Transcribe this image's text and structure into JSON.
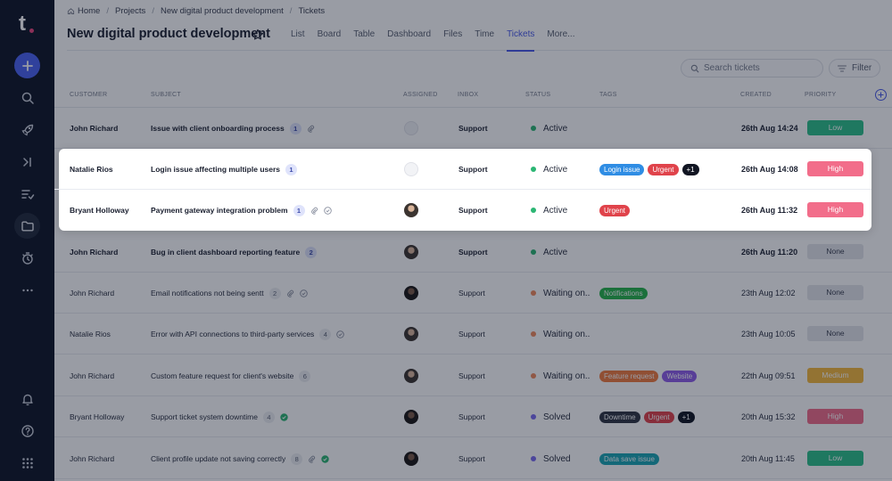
{
  "breadcrumb": [
    "Home",
    "Projects",
    "New digital product development",
    "Tickets"
  ],
  "page_title": "New digital product development",
  "tabs": [
    "List",
    "Board",
    "Table",
    "Dashboard",
    "Files",
    "Time",
    "Tickets",
    "More..."
  ],
  "active_tab": "Tickets",
  "search": {
    "placeholder": "Search tickets"
  },
  "filter_label": "Filter",
  "columns": {
    "customer": "CUSTOMER",
    "subject": "SUBJECT",
    "assigned": "ASSIGNED",
    "inbox": "INBOX",
    "status": "STATUS",
    "tags": "TAGS",
    "created": "CREATED",
    "priority": "PRIORITY"
  },
  "rows": [
    {
      "customer": "John Richard",
      "subject": "Issue with client onboarding process",
      "count": "1",
      "inbox": "Support",
      "status": "Active",
      "created": "26th Aug  14:24",
      "priority": "Low"
    },
    {
      "customer": "Natalie Rios",
      "subject": "Login issue affecting multiple users",
      "count": "1",
      "inbox": "Support",
      "status": "Active",
      "tags": [
        "Login issue",
        "Urgent",
        "+1"
      ],
      "created": "26th Aug  14:08",
      "priority": "High"
    },
    {
      "customer": "Bryant Holloway",
      "subject": "Payment gateway integration problem",
      "count": "1",
      "inbox": "Support",
      "status": "Active",
      "tags": [
        "Urgent"
      ],
      "created": "26th Aug  11:32",
      "priority": "High"
    },
    {
      "customer": "John Richard",
      "subject": "Bug in client dashboard reporting feature",
      "count": "2",
      "inbox": "Support",
      "status": "Active",
      "created": "26th Aug  11:20",
      "priority": "None"
    },
    {
      "customer": "John Richard",
      "subject": "Email notifications not being sentt",
      "count": "2",
      "inbox": "Support",
      "status": "Waiting on..",
      "tags": [
        "Notifications"
      ],
      "created": "23th Aug  12:02",
      "priority": "None"
    },
    {
      "customer": "Natalie Rios",
      "subject": "Error with API connections to third-party services",
      "count": "4",
      "inbox": "Support",
      "status": "Waiting on..",
      "created": "23th Aug  10:05",
      "priority": "None"
    },
    {
      "customer": "John Richard",
      "subject": "Custom feature request for client's website",
      "count": "6",
      "inbox": "Support",
      "status": "Waiting on..",
      "tags": [
        "Feature request",
        "Website"
      ],
      "created": "22th Aug  09:51",
      "priority": "Medium"
    },
    {
      "customer": "Bryant Holloway",
      "subject": "Support ticket system downtime",
      "count": "4",
      "inbox": "Support",
      "status": "Solved",
      "tags": [
        "Downtime",
        "Urgent",
        "+1"
      ],
      "created": "20th Aug  15:32",
      "priority": "High"
    },
    {
      "customer": "John Richard",
      "subject": "Client profile update not saving correctly",
      "count": "8",
      "inbox": "Support",
      "status": "Solved",
      "tags": [
        "Data save issue"
      ],
      "created": "20th Aug  11:45",
      "priority": "Low"
    }
  ],
  "colors": {
    "sidebar": "#0e1526",
    "accent": "#4a5be8",
    "status_active": "#2bb673",
    "status_waiting": "#f08a5d",
    "status_solved": "#7b6cf0",
    "priority_low": "#2ec18b",
    "priority_high": "#f26d8a",
    "priority_medium": "#f5b83d",
    "priority_none": "#e4e6eb"
  }
}
